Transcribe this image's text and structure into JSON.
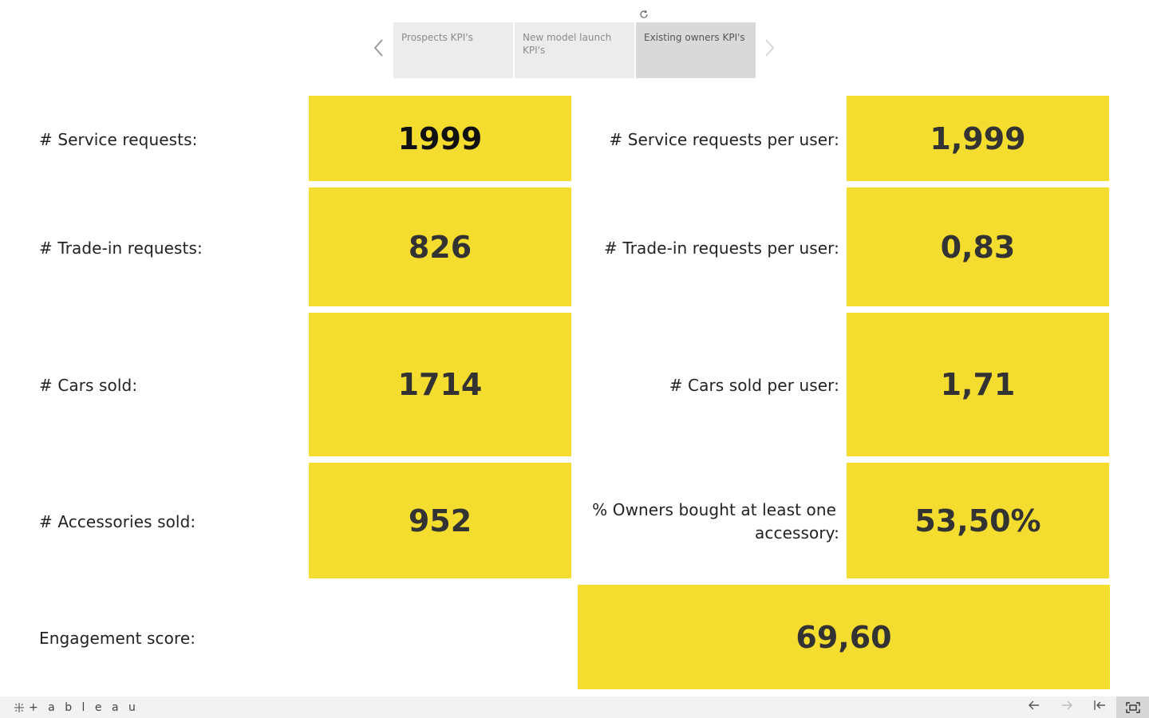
{
  "story_nav": {
    "tabs": [
      {
        "label": "Prospects KPI's"
      },
      {
        "label": "New model launch KPI's"
      },
      {
        "label": "Existing owners KPI's"
      }
    ],
    "prev_icon": "chevron-left-icon",
    "next_icon": "chevron-right-icon",
    "refresh_icon": "refresh-icon"
  },
  "kpis": {
    "service_requests": {
      "label": "# Service requests:",
      "value": "1999"
    },
    "trade_in_requests": {
      "label": "# Trade-in requests:",
      "value": "826"
    },
    "cars_sold": {
      "label": "# Cars sold:",
      "value": "1714"
    },
    "accessories_sold": {
      "label": "# Accessories sold:",
      "value": "952"
    },
    "service_requests_per_user": {
      "label": "# Service requests per user:",
      "value": "1,999"
    },
    "trade_in_requests_per_user": {
      "label": "# Trade-in requests per user:",
      "value": "0,83"
    },
    "cars_sold_per_user": {
      "label": "# Cars sold per user:",
      "value": "1,71"
    },
    "owners_accessory": {
      "label_line1": "% Owners bought at least one",
      "label_line2": "accessory:",
      "value": "53,50%"
    },
    "engagement_score": {
      "label": "Engagement score:",
      "value": "69,60"
    }
  },
  "colors": {
    "tile": "#f5dd30",
    "background": "#ffffff",
    "toolbar": "#f2f2f2"
  },
  "toolbar": {
    "brand": "+ a b l e a u",
    "brand_text": "tableau",
    "undo_icon": "arrow-left-icon",
    "redo_icon": "arrow-right-icon",
    "revert_icon": "revert-to-start-icon",
    "fullscreen_icon": "fullscreen-icon"
  }
}
